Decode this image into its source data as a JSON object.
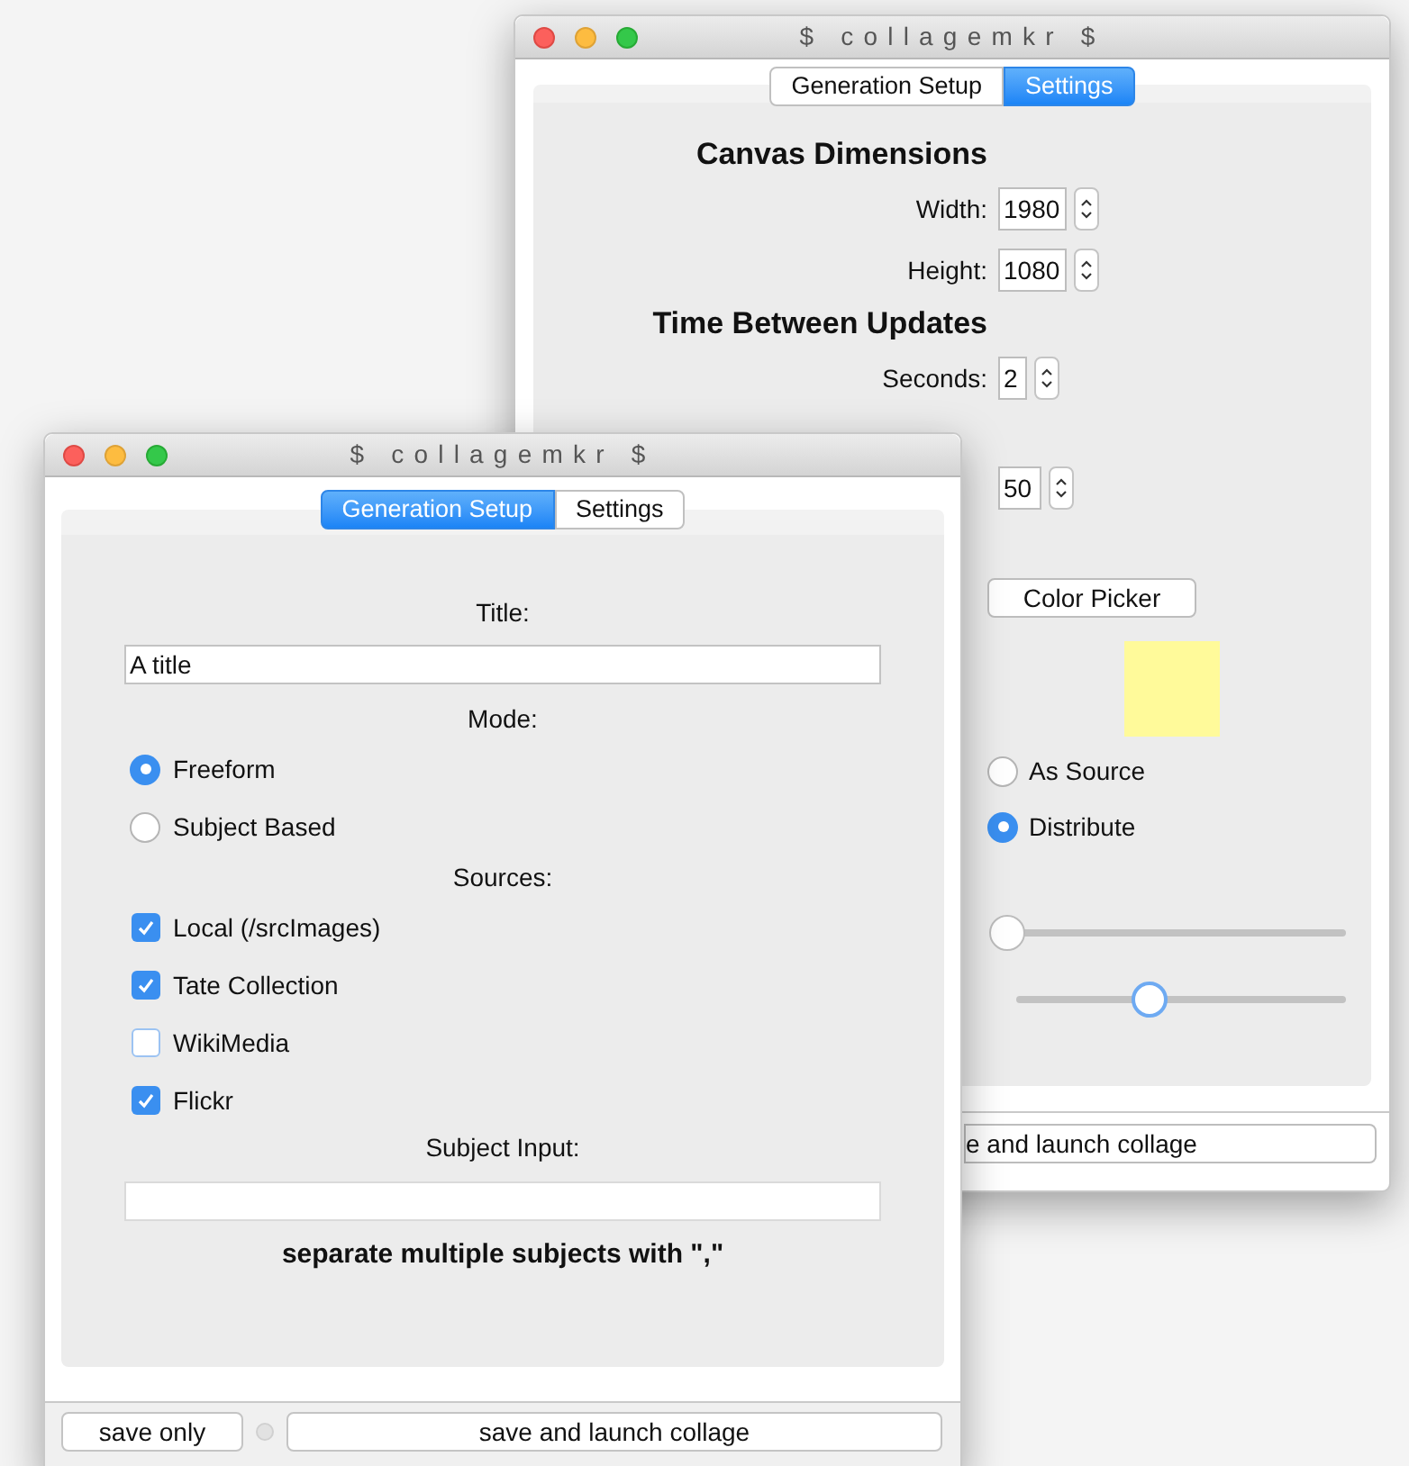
{
  "settings_window": {
    "title": "$ collagemkr $",
    "tabs": [
      {
        "label": "Generation Setup",
        "selected": false
      },
      {
        "label": "Settings",
        "selected": true
      }
    ],
    "canvas_heading": "Canvas Dimensions",
    "fields": [
      {
        "label": "Width:",
        "value": "1980"
      },
      {
        "label": "Height:",
        "value": "1080"
      }
    ],
    "time_heading": "Time Between Updates",
    "seconds": {
      "label": "Seconds:",
      "value": "2"
    },
    "spinner_value": "50",
    "color_button": "Color Picker",
    "swatch": {
      "color": "#fffa9a"
    },
    "radios": [
      {
        "label": "As Source",
        "selected": false
      },
      {
        "label": "Distribute",
        "selected": true
      }
    ],
    "sliders": [
      {
        "level": 0
      },
      {
        "level": 0.42
      }
    ],
    "bottom_button": "e and launch collage"
  },
  "setup_window": {
    "title": "$ collagemkr $",
    "tabs": [
      {
        "label": "Generation Setup",
        "selected": true
      },
      {
        "label": "Settings",
        "selected": false
      }
    ],
    "title_label": "Title:",
    "title_value": "A title",
    "mode_label": "Mode:",
    "modes": [
      {
        "label": "Freeform",
        "selected": true
      },
      {
        "label": "Subject Based",
        "selected": false
      }
    ],
    "sources_label": "Sources:",
    "sources": [
      {
        "label": "Local (/srcImages)",
        "checked": true
      },
      {
        "label": "Tate Collection",
        "checked": true
      },
      {
        "label": "WikiMedia",
        "checked": false
      },
      {
        "label": "Flickr",
        "checked": true
      }
    ],
    "subject_label": "Subject Input:",
    "hint": "separate multiple subjects with \",\"",
    "buttons": [
      "save only",
      "save and launch collage"
    ]
  }
}
